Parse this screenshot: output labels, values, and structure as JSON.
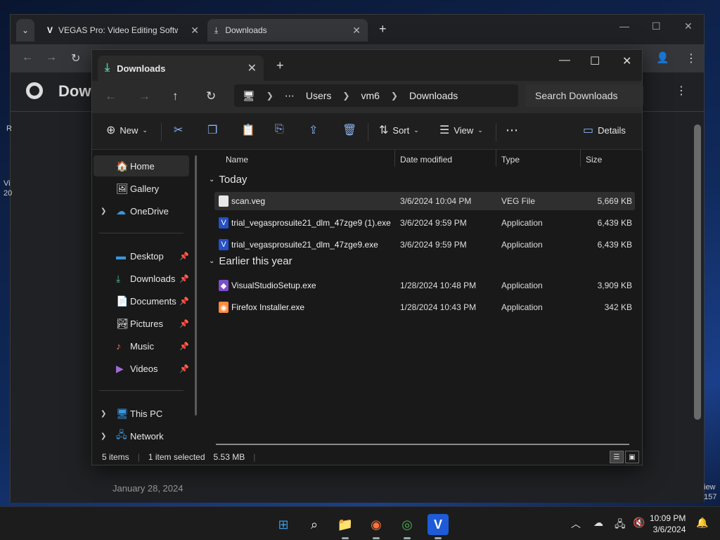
{
  "chrome": {
    "tabs": [
      {
        "label": "VEGAS Pro: Video Editing Softw",
        "icon": "vegas-icon"
      },
      {
        "label": "Downloads",
        "icon": "download-icon"
      }
    ],
    "page_title": "Dow",
    "date_text": "January 28, 2024",
    "left_fragments": [
      "R",
      "Vi",
      "20"
    ],
    "right_fragments": [
      "iew",
      "157"
    ]
  },
  "explorer": {
    "tab_title": "Downloads",
    "breadcrumb": [
      "Users",
      "vm6",
      "Downloads"
    ],
    "search_placeholder": "Search Downloads",
    "toolbar": {
      "new": "New",
      "sort": "Sort",
      "view": "View",
      "details": "Details"
    },
    "nav": [
      {
        "label": "Home",
        "icon": "home-icon",
        "selected": true
      },
      {
        "label": "Gallery",
        "icon": "gallery-icon"
      },
      {
        "label": "OneDrive",
        "icon": "cloud-icon",
        "expandable": true
      },
      {
        "label": "Desktop",
        "icon": "desktop-icon",
        "pinned": true
      },
      {
        "label": "Downloads",
        "icon": "download-icon",
        "pinned": true
      },
      {
        "label": "Documents",
        "icon": "document-icon",
        "pinned": true
      },
      {
        "label": "Pictures",
        "icon": "picture-icon",
        "pinned": true
      },
      {
        "label": "Music",
        "icon": "music-icon",
        "pinned": true
      },
      {
        "label": "Videos",
        "icon": "video-icon",
        "pinned": true
      },
      {
        "label": "This PC",
        "icon": "pc-icon",
        "expandable": true
      },
      {
        "label": "Network",
        "icon": "network-icon",
        "expandable": true
      }
    ],
    "columns": [
      "Name",
      "Date modified",
      "Type",
      "Size"
    ],
    "groups": [
      {
        "label": "Today",
        "files": [
          {
            "name": "scan.veg",
            "date": "3/6/2024 10:04 PM",
            "type": "VEG File",
            "size": "5,669 KB",
            "icon": "file-icon",
            "selected": true
          },
          {
            "name": "trial_vegasprosuite21_dlm_47zge9 (1).exe",
            "date": "3/6/2024 9:59 PM",
            "type": "Application",
            "size": "6,439 KB",
            "icon": "vegas-icon"
          },
          {
            "name": "trial_vegasprosuite21_dlm_47zge9.exe",
            "date": "3/6/2024 9:59 PM",
            "type": "Application",
            "size": "6,439 KB",
            "icon": "vegas-icon"
          }
        ]
      },
      {
        "label": "Earlier this year",
        "files": [
          {
            "name": "VisualStudioSetup.exe",
            "date": "1/28/2024 10:48 PM",
            "type": "Application",
            "size": "3,909 KB",
            "icon": "visual-studio-icon"
          },
          {
            "name": "Firefox Installer.exe",
            "date": "1/28/2024 10:43 PM",
            "type": "Application",
            "size": "342 KB",
            "icon": "firefox-icon"
          }
        ]
      }
    ],
    "status": {
      "items": "5 items",
      "selected": "1 item selected",
      "size": "5.53 MB"
    }
  },
  "taskbar": {
    "time": "10:09 PM",
    "date": "3/6/2024"
  }
}
